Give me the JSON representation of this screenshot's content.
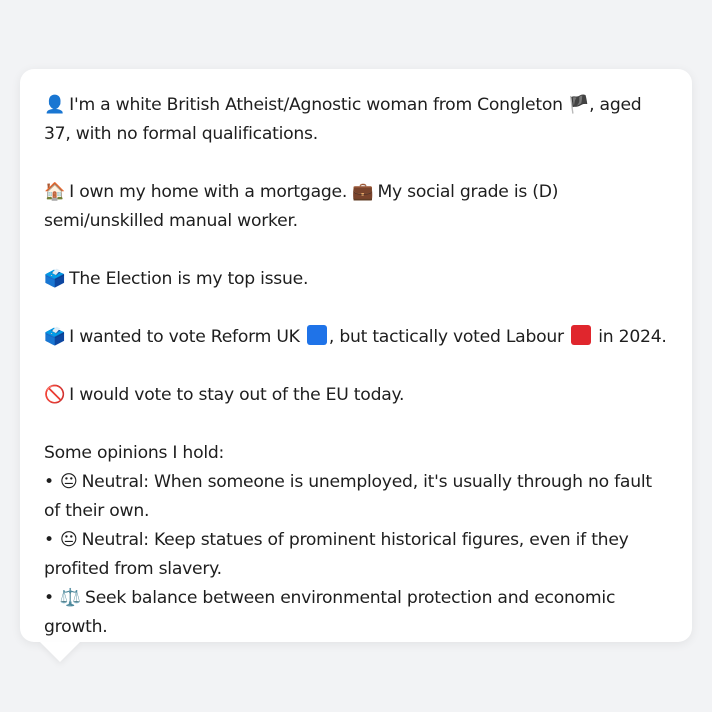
{
  "bio": {
    "line1_icon": "👤",
    "line1_text_a": "I'm a white British Atheist/Agnostic woman from Congleton",
    "line1_flag": "🏴",
    "line1_text_b": ", aged 37, with no formal qualifications.",
    "home_icon": "🏠",
    "home_text": "I own my home with a mortgage.",
    "grade_icon": "💼",
    "grade_text": "My social grade is (D) semi/unskilled manual worker."
  },
  "issue": {
    "icon": "🗳️",
    "text": "The Election is my top issue."
  },
  "vote": {
    "icon": "🗳️",
    "text_a": "I wanted to vote Reform UK",
    "reform_color": "#1f73e8",
    "text_b": ", but tactically voted Labour",
    "labour_color": "#e0262d",
    "text_c": "in 2024."
  },
  "eu": {
    "icon": "🚫",
    "text": "I would vote to stay out of the EU today."
  },
  "opinions": {
    "heading": "Some opinions I hold:",
    "bullet": "•",
    "items": [
      {
        "icon": "😐",
        "text": "Neutral: When someone is unemployed, it's usually through no fault of their own."
      },
      {
        "icon": "😐",
        "text": "Neutral: Keep statues of prominent historical figures, even if they profited from slavery."
      },
      {
        "icon": "⚖️",
        "text": "Seek balance between environmental protection and economic growth."
      }
    ]
  }
}
